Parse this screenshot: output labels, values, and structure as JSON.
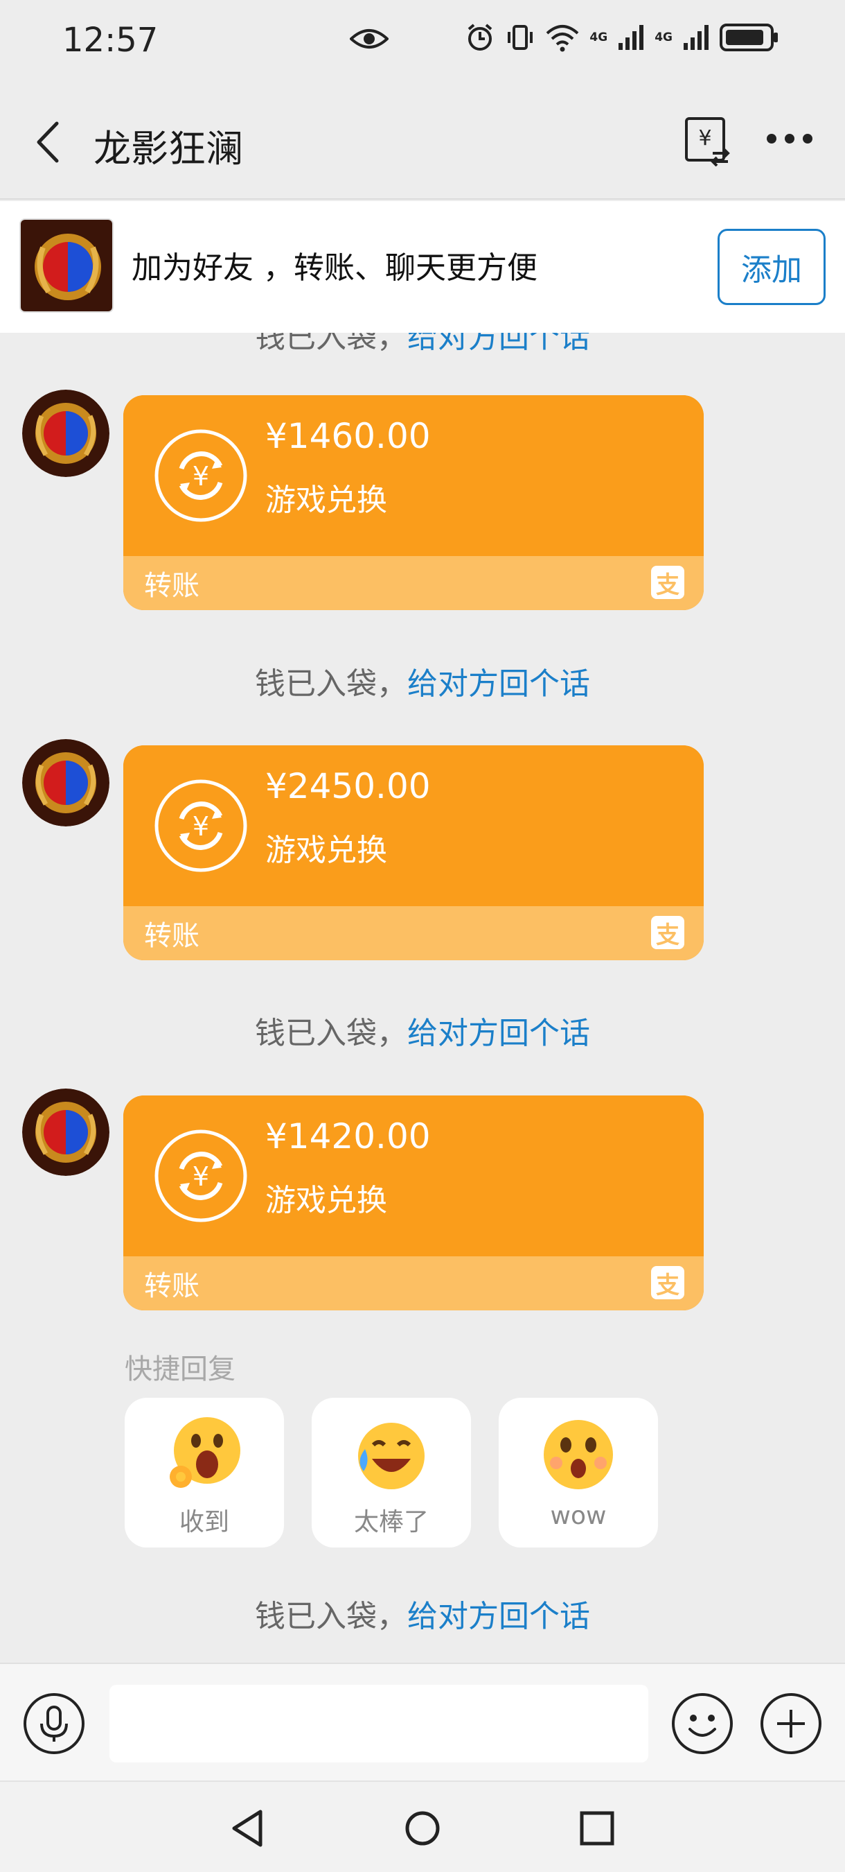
{
  "status_bar": {
    "time": "12:57",
    "net1": "4G",
    "net2": "4G"
  },
  "header": {
    "title": "龙影狂澜"
  },
  "banner": {
    "text": "加为好友 ，转账、聊天更方便",
    "add_label": "添加"
  },
  "notices": [
    {
      "text": "钱已入袋，",
      "link": "给对方回个话"
    },
    {
      "text": "钱已入袋，",
      "link": "给对方回个话"
    },
    {
      "text": "钱已入袋，",
      "link": "给对方回个话"
    },
    {
      "text": "钱已入袋，",
      "link": "给对方回个话"
    }
  ],
  "transfers": [
    {
      "amount": "¥1460.00",
      "note": "游戏兑换",
      "label": "转账",
      "brand_mark": "支"
    },
    {
      "amount": "¥2450.00",
      "note": "游戏兑换",
      "label": "转账",
      "brand_mark": "支"
    },
    {
      "amount": "¥1420.00",
      "note": "游戏兑换",
      "label": "转账",
      "brand_mark": "支"
    }
  ],
  "quick_reply": {
    "title": "快捷回复",
    "items": [
      {
        "label": "收到",
        "icon": "ok-hand-emoji-icon"
      },
      {
        "label": "太棒了",
        "icon": "laugh-cry-emoji-icon"
      },
      {
        "label": "wow",
        "icon": "surprised-emoji-icon"
      }
    ]
  },
  "input": {
    "placeholder": ""
  },
  "colors": {
    "card": "#fa9d1b",
    "card_footer": "#fcbf63",
    "link": "#1b7fc9",
    "background": "#ededed"
  }
}
